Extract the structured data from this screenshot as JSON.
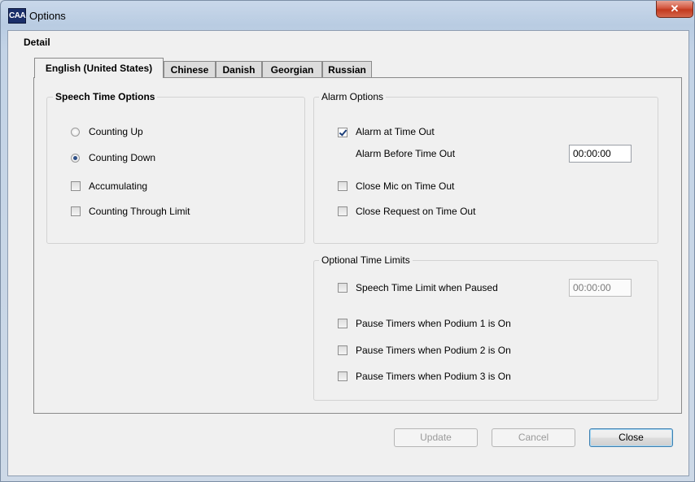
{
  "window": {
    "title": "Options",
    "app_icon_text": "CAA"
  },
  "detail_label": "Detail",
  "tabs": [
    {
      "label": "English (United States)",
      "active": true
    },
    {
      "label": "Chinese",
      "active": false
    },
    {
      "label": "Danish",
      "active": false
    },
    {
      "label": "Georgian",
      "active": false
    },
    {
      "label": "Russian",
      "active": false
    }
  ],
  "speech_time_options": {
    "title": "Speech Time Options",
    "counting_up": {
      "label": "Counting Up",
      "selected": false
    },
    "counting_down": {
      "label": "Counting Down",
      "selected": true
    },
    "accumulating": {
      "label": "Accumulating",
      "checked": false
    },
    "counting_through_limit": {
      "label": "Counting Through Limit",
      "checked": false
    }
  },
  "alarm_options": {
    "title": "Alarm Options",
    "alarm_at_time_out": {
      "label": "Alarm at Time Out",
      "checked": true
    },
    "alarm_before_time_out": {
      "label": "Alarm Before Time Out",
      "value": "00:00:00"
    },
    "close_mic_on_time_out": {
      "label": "Close Mic on Time Out",
      "checked": false
    },
    "close_request_on_time_out": {
      "label": "Close Request on Time Out",
      "checked": false
    }
  },
  "optional_time_limits": {
    "title": "Optional Time Limits",
    "speech_time_limit_paused": {
      "label": "Speech Time Limit when Paused",
      "checked": false,
      "value": "00:00:00"
    },
    "pause_podium_1": {
      "label": "Pause Timers when Podium 1 is On",
      "checked": false
    },
    "pause_podium_2": {
      "label": "Pause Timers when Podium 2 is On",
      "checked": false
    },
    "pause_podium_3": {
      "label": "Pause Timers when Podium 3 is On",
      "checked": false
    }
  },
  "buttons": {
    "update": "Update",
    "cancel": "Cancel",
    "close": "Close"
  },
  "icons": {
    "close": "close-icon",
    "app": "app-icon"
  },
  "colors": {
    "accent": "#3c7fb1",
    "close_button": "#c23a1f",
    "title_bar": "#b9cce2"
  }
}
